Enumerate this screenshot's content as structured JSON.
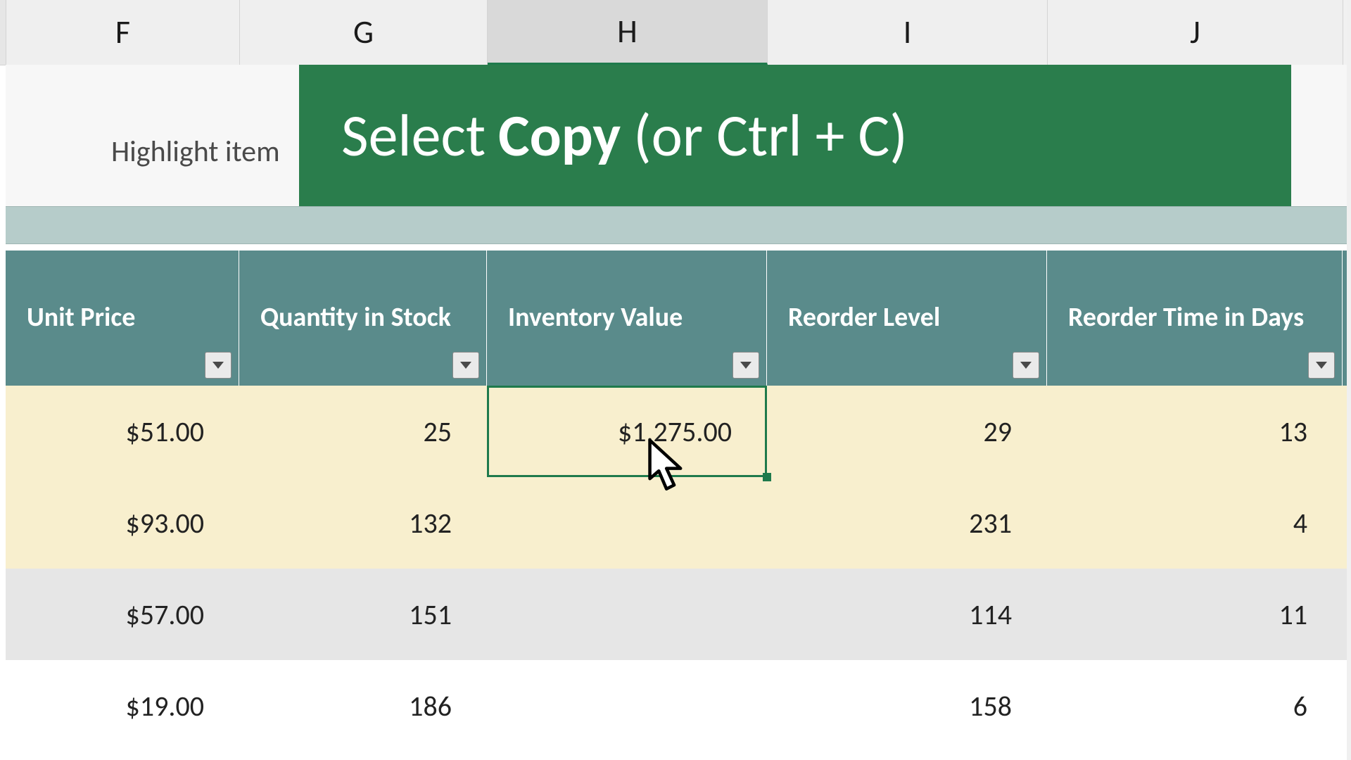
{
  "columnHeaders": {
    "F": "F",
    "G": "G",
    "H": "H",
    "I": "I",
    "J": "J",
    "selectedCol": "H"
  },
  "infoband": {
    "highlight_text": "Highlight item"
  },
  "banner": {
    "prefix": "Select ",
    "bold": "Copy",
    "suffix": " (or Ctrl + C)"
  },
  "table": {
    "headers": {
      "unit_price": "Unit Price",
      "qty": "Quantity in Stock",
      "inv_value": "Inventory Value",
      "reorder_level": "Reorder Level",
      "reorder_days": "Reorder Time in Days"
    },
    "rows": [
      {
        "unit_price": "$51.00",
        "qty": "25",
        "inv_value": "$1,275.00",
        "reorder_level": "29",
        "reorder_days": "13"
      },
      {
        "unit_price": "$93.00",
        "qty": "132",
        "inv_value": "",
        "reorder_level": "231",
        "reorder_days": "4"
      },
      {
        "unit_price": "$57.00",
        "qty": "151",
        "inv_value": "",
        "reorder_level": "114",
        "reorder_days": "11"
      },
      {
        "unit_price": "$19.00",
        "qty": "186",
        "inv_value": "",
        "reorder_level": "158",
        "reorder_days": "6"
      }
    ],
    "selected_cell": {
      "row": 0,
      "col": "H"
    }
  }
}
